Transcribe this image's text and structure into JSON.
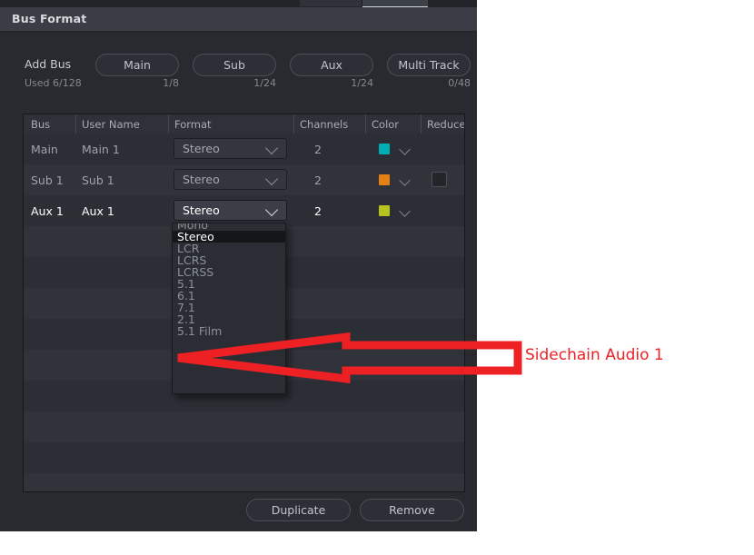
{
  "window": {
    "title": "Bus Format"
  },
  "add_bus": {
    "label": "Add Bus",
    "used": "Used 6/128",
    "buttons": [
      {
        "label": "Main",
        "count": "1/8"
      },
      {
        "label": "Sub",
        "count": "1/24"
      },
      {
        "label": "Aux",
        "count": "1/24"
      },
      {
        "label": "Multi Track",
        "count": "0/48"
      }
    ]
  },
  "table": {
    "headers": [
      "Bus",
      "User Name",
      "Format",
      "Channels",
      "Color",
      "Reduce"
    ],
    "rows": [
      {
        "bus": "Main",
        "user_name": "Main 1",
        "format": "Stereo",
        "channels": "2",
        "color": "#00adb4",
        "reduce": false,
        "active": false
      },
      {
        "bus": "Sub 1",
        "user_name": "Sub 1",
        "format": "Stereo",
        "channels": "2",
        "color": "#e38113",
        "reduce": true,
        "active": false
      },
      {
        "bus": "Aux 1",
        "user_name": "Aux 1",
        "format": "Stereo",
        "channels": "2",
        "color": "#b4c41d",
        "reduce": false,
        "active": true
      }
    ]
  },
  "format_dropdown": {
    "selected": "Stereo",
    "options": [
      "Mono",
      "Stereo",
      "LCR",
      "LCRS",
      "LCRSS",
      "5.1",
      "6.1",
      "7.1",
      "2.1",
      "5.1 Film"
    ]
  },
  "footer": {
    "duplicate_label": "Duplicate",
    "remove_label": "Remove"
  },
  "annotation": {
    "text": "Sidechain Audio 1",
    "color": "#ed2024"
  }
}
